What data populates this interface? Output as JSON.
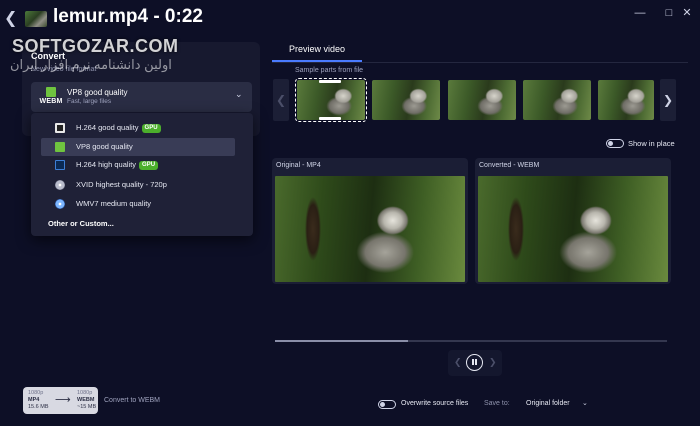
{
  "window": {
    "title": "lemur.mp4 - 0:22",
    "back_icon": "arrow-left-icon",
    "controls": [
      "minimize-icon",
      "maximize-icon",
      "close-icon"
    ]
  },
  "watermark": {
    "line1": "SOFTGOZAR.COM",
    "line2": "اولین دانشنامه نرم افزار ایران"
  },
  "convert": {
    "title": "Convert",
    "subtitle": "New video file format",
    "selected": {
      "badge": "WEBM",
      "name": "VP8 good quality",
      "description": "Fast, large files",
      "icon_color": "#6fc43f"
    },
    "options": [
      {
        "label": "H.264 good quality",
        "gpu": true,
        "icon": "h264-icon",
        "selected": false
      },
      {
        "label": "VP8 good quality",
        "gpu": false,
        "icon": "vp8-icon",
        "selected": true
      },
      {
        "label": "H.264 high quality",
        "gpu": true,
        "icon": "h264-high-icon",
        "selected": false
      },
      {
        "label": "XVID highest quality - 720p",
        "gpu": false,
        "icon": "xvid-disc-icon",
        "selected": false
      },
      {
        "label": "WMV7 medium quality",
        "gpu": false,
        "icon": "wmv-disc-icon",
        "selected": false
      }
    ],
    "gpu_label": "GPU",
    "other_label": "Other or Custom..."
  },
  "preview": {
    "tab_label": "Preview video",
    "sample_label": "Sample parts from file",
    "thumbnail_count": 5,
    "active_thumbnail": 0,
    "show_in_place_label": "Show in place",
    "show_in_place_on": false,
    "original_label": "Original - MP4",
    "converted_label": "Converted - WEBM",
    "timeline_progress": 0.34,
    "play_state": "paused"
  },
  "bottom": {
    "summary": {
      "src_res": "1080p",
      "src_format": "MP4",
      "src_size": "15.6 MB",
      "dst_res": "1080p",
      "dst_format": "WEBM",
      "dst_size": "~15 MB"
    },
    "convert_to_label": "Convert to WEBM",
    "overwrite_label": "Overwrite source files",
    "save_to_label": "Save to:",
    "save_to_value": "Original folder"
  },
  "colors": {
    "background": "#0d0f26",
    "accent": "#4a7bff",
    "gpu_badge": "#4caf2c"
  }
}
